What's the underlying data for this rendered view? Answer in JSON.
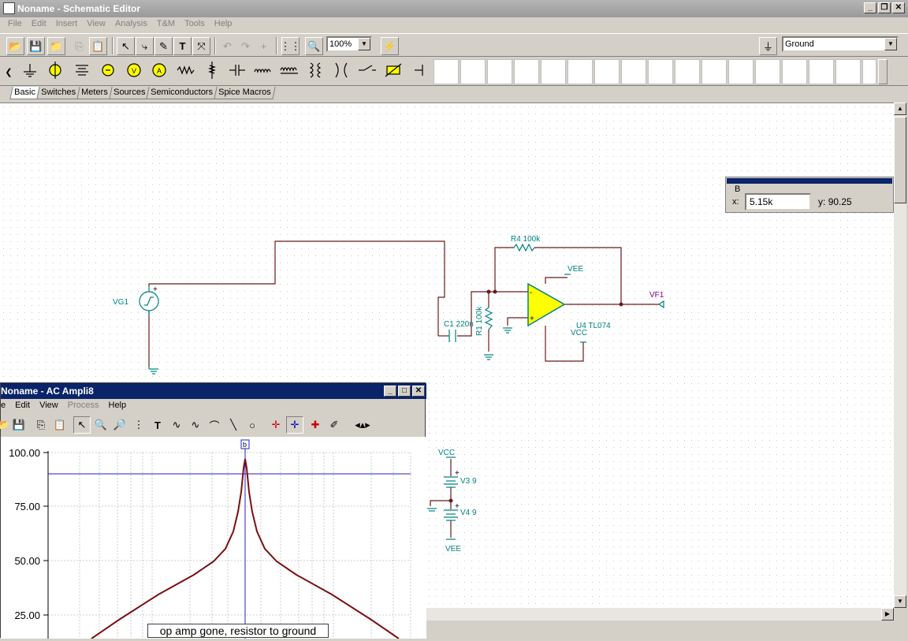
{
  "window": {
    "title": "Noname - Schematic Editor"
  },
  "menu": [
    "File",
    "Edit",
    "Insert",
    "View",
    "Analysis",
    "T&M",
    "Tools",
    "Help"
  ],
  "toolbar": {
    "zoom": "100%",
    "component_select": "Ground"
  },
  "tabs": [
    "Basic",
    "Switches",
    "Meters",
    "Sources",
    "Semiconductors",
    "Spice Macros"
  ],
  "coord_panel": {
    "cursor_label": "B",
    "x_label": "x:",
    "x_value": "5.15k",
    "y_label": "y:",
    "y_value": "90.25"
  },
  "schematic": {
    "vg1": "VG1",
    "r4": "R4 100k",
    "vee_top": "VEE",
    "vf1": "VF1",
    "c1": "C1 220n",
    "r1": "R1 100k",
    "u4": "U4 TL074",
    "vcc_mid": "VCC",
    "vcc_supply": "VCC",
    "v3": "V3 9",
    "v4": "V4 9",
    "vee_supply": "VEE",
    "plus": "+",
    "minus": "-"
  },
  "subwindow": {
    "title": "Noname - AC Ampli8",
    "menu": [
      "e",
      "Edit",
      "View",
      "Process",
      "Help"
    ],
    "cursor_marker": "b",
    "y_ticks": [
      "100.00",
      "75.00",
      "50.00",
      "25.00"
    ],
    "caption": "op amp gone, resistor to ground"
  },
  "colors": {
    "title_active": "#0a246a",
    "trace": "#7a1010",
    "schematic_wire": "#6b1a1a",
    "component": "#008080",
    "opamp_fill": "#ffff00",
    "cursor_line": "#2020c0"
  }
}
